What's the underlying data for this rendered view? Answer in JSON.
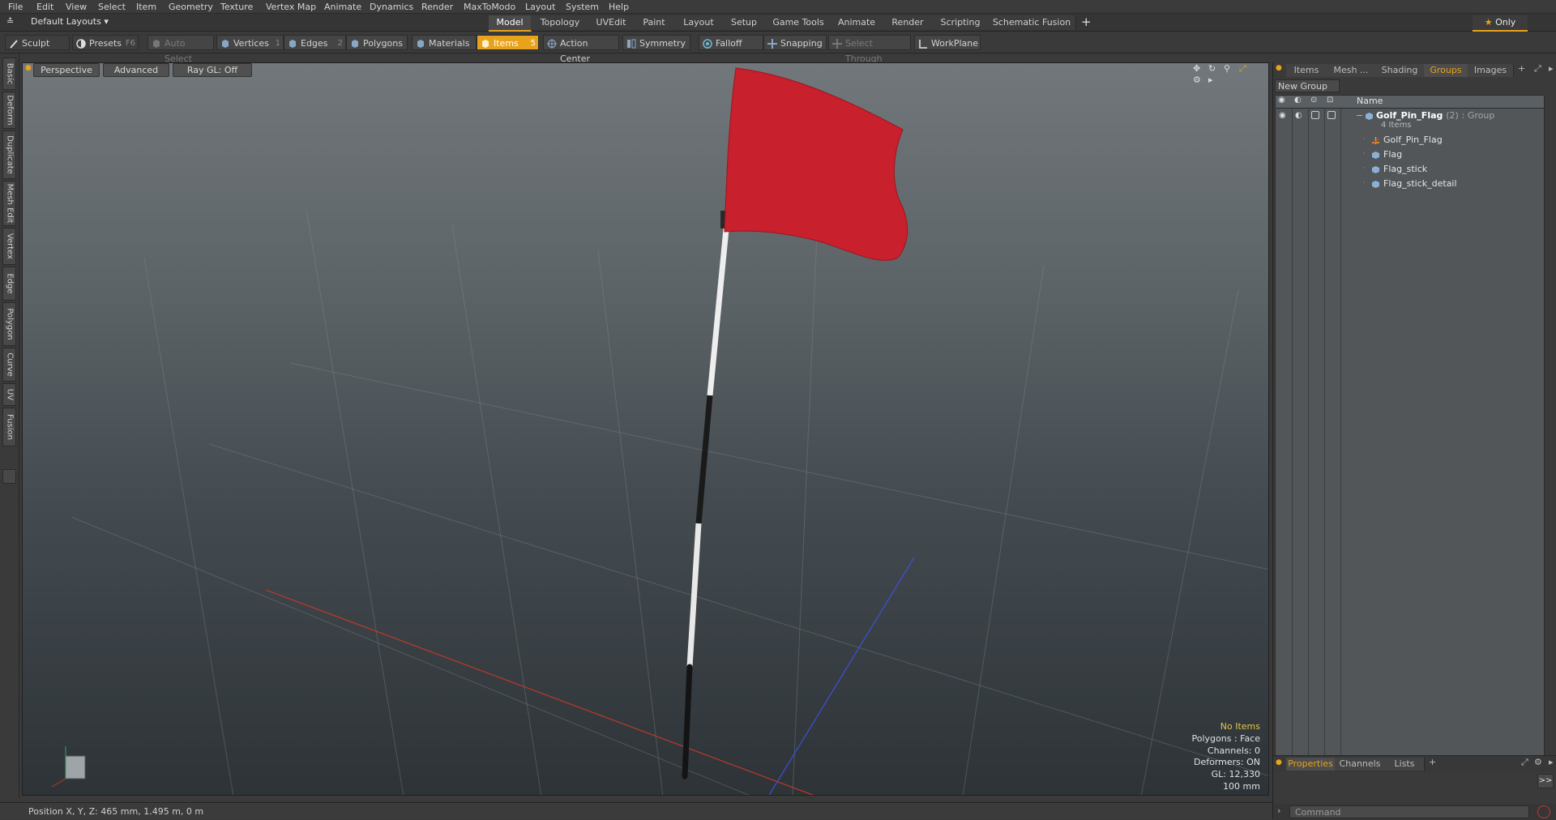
{
  "menu": [
    "File",
    "Edit",
    "View",
    "Select",
    "Item",
    "Geometry",
    "Texture",
    "Vertex Map",
    "Animate",
    "Dynamics",
    "Render",
    "MaxToModo",
    "Layout",
    "System",
    "Help"
  ],
  "layout_selector": "Default Layouts",
  "layout_tabs": [
    "Model",
    "Topology",
    "UVEdit",
    "Paint",
    "Layout",
    "Setup",
    "Game Tools",
    "Animate",
    "Render",
    "Scripting",
    "Schematic Fusion"
  ],
  "layout_active": "Model",
  "only_label": "Only",
  "toolbar": {
    "sculpt": "Sculpt",
    "presets": "Presets",
    "presets_key": "F6",
    "auto_select": "Auto Select",
    "vertices": "Vertices",
    "vertices_num": "1",
    "edges": "Edges",
    "edges_num": "2",
    "polygons": "Polygons",
    "materials": "Materials",
    "items": "Items",
    "items_num": "5",
    "action_center": "Action Center",
    "symmetry": "Symmetry",
    "falloff": "Falloff",
    "snapping": "Snapping",
    "select_through": "Select Through",
    "workplane": "WorkPlane"
  },
  "left_tabs": [
    "Basic",
    "Deform",
    "Duplicate",
    "Mesh Edit",
    "Vertex",
    "Edge",
    "Polygon",
    "Curve",
    "UV",
    "Fusion"
  ],
  "viewport": {
    "view": "Perspective",
    "mode": "Advanced",
    "raygl": "Ray GL: Off"
  },
  "info": {
    "no_items": "No Items",
    "polygons": "Polygons : Face",
    "channels": "Channels: 0",
    "deformers": "Deformers: ON",
    "gl": "GL: 12,330",
    "scale": "100 mm"
  },
  "status": "Position X, Y, Z:  465 mm, 1.495 m, 0 m",
  "right_panel": {
    "tabs": [
      "Items",
      "Mesh ...",
      "Shading",
      "Groups",
      "Images"
    ],
    "active_tab": "Groups",
    "new_group": "New Group",
    "col_name": "Name",
    "group": {
      "name": "Golf_Pin_Flag",
      "count": "(2)",
      "type": ": Group",
      "sub": "4 Items"
    },
    "items": [
      "Golf_Pin_Flag",
      "Flag",
      "Flag_stick",
      "Flag_stick_detail"
    ],
    "bottom_tabs": [
      "Properties",
      "Channels",
      "Lists"
    ],
    "bottom_active": "Properties",
    "command_placeholder": "Command"
  },
  "colors": {
    "accent": "#e8a21b",
    "flag": "#c8202c"
  }
}
